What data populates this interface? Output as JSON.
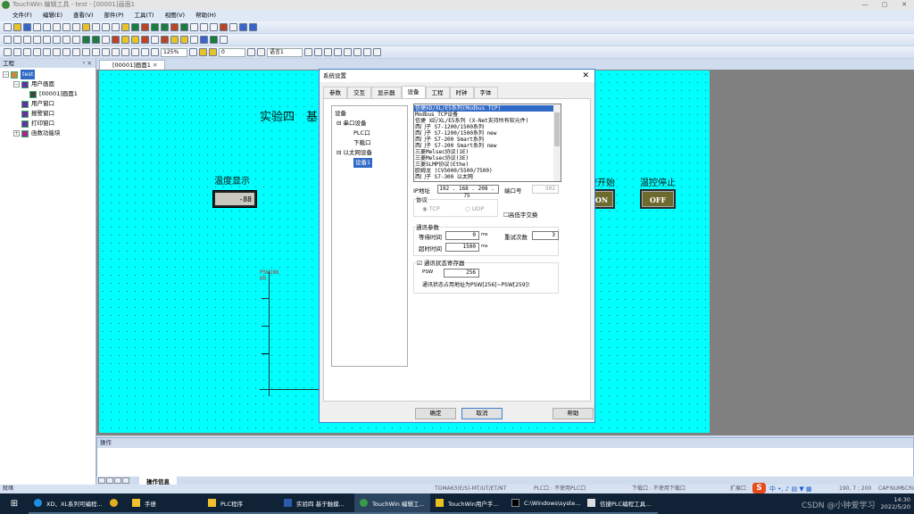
{
  "window": {
    "title": "TouchWin 编辑工具 - test - [00001]画面1",
    "controls": [
      "—",
      "▢",
      "✕"
    ]
  },
  "menu": [
    "文件(F)",
    "编辑(E)",
    "查看(V)",
    "部件(P)",
    "工具(T)",
    "视图(V)",
    "帮助(H)"
  ],
  "toolbar": {
    "zoom": "125%",
    "value": "0",
    "language": "语言1"
  },
  "project_panel": {
    "title": "工程",
    "pin": "ᵖ ✕",
    "tree": [
      {
        "label": "test",
        "level": 0,
        "selected": true
      },
      {
        "label": "用户画面",
        "level": 1
      },
      {
        "label": "[00001]画面1",
        "level": 2
      },
      {
        "label": "用户窗口",
        "level": 1
      },
      {
        "label": "报警窗口",
        "level": 1
      },
      {
        "label": "打印窗口",
        "level": 1
      },
      {
        "label": "函数功能块",
        "level": 1
      }
    ]
  },
  "editor": {
    "tab": "[00001]画面1",
    "close": "✕"
  },
  "canvas": {
    "title": "实验四　基",
    "temp_label": "温度显示",
    "temp_value": "-88",
    "start_label": "控开始",
    "start_btn": "ON",
    "stop_label": "温控停止",
    "stop_btn": "OFF",
    "trend_label": "PSW286",
    "trend_sub": "00",
    "colors": {
      "canvas": "#00ffff",
      "lamp": "#6c6a2c"
    }
  },
  "dialog": {
    "title": "系统设置",
    "close": "✕",
    "tabs": [
      "参数",
      "交互",
      "显示器",
      "设备",
      "工程",
      "时钟",
      "字体"
    ],
    "active_tab": "设备",
    "device_tree": [
      "设备",
      "串口设备",
      "PLC口",
      "下载口",
      "以太网设备",
      "设备1"
    ],
    "plc_list": [
      "信捷XD/XL/E5系列(Modbus TCP)",
      "Modbus_TCP设备",
      "信捷 XD/XL/E5系列 (X-Net支持所有软元件)",
      "西门子 S7-1200/1500系列",
      "西门子 S7-1200/1500系列 new",
      "西门子 S7-200 Smart系列",
      "西门子 S7-200 Smart系列 new",
      "三菱Melsec协议(1E)",
      "三菱Melsec协议(3E)",
      "三菱SLMP协议(Ethe)",
      "欧姆龙 (CV5000/5500/7500)",
      "西门子 S7-300 以太网"
    ],
    "ip_label": "IP地址",
    "ip": "192 . 168 . 208 . 75",
    "port_label": "端口号",
    "port": "502",
    "protocol_label": "协议",
    "tcp": "TCP",
    "udp": "UDP",
    "swap_label": "高低字交换",
    "comm_label": "通讯参数",
    "wait_label": "等待时间",
    "wait": "0",
    "ms": "ms",
    "retry_label": "重试次数",
    "retry": "3",
    "timeout_label": "超时时间",
    "timeout": "1500",
    "status_reg_label": "通讯状态寄存器",
    "psw_label": "PSW",
    "psw": "256",
    "note": "通讯状态占用地址为PSW[256]~PSW[259]!",
    "ok": "确定",
    "cancel": "取消",
    "help": "帮助"
  },
  "bottom_panel": {
    "title": "操作",
    "tab": "操作信息"
  },
  "statusbar": {
    "ready": "就绪",
    "model": "TGMA63(E/S)-MT/UT/ET/NT",
    "plc": "PLC口 : 不使用PLC口",
    "download": "下载口 : 不使用下载口",
    "ext": "扩展口 :",
    "pos": "190, 7 : 200",
    "caps": "CAP",
    "num": "NUM",
    "scrl": "SCRL"
  },
  "taskbar": {
    "items": [
      "XD、XL系列可编程...",
      "",
      "手册",
      "PLC程序",
      "实验四 基于触摸...",
      "TouchWin 编辑工...",
      "TouchWin用户手...",
      "C:\\Windows\\syste...",
      "信捷PLC编程工具..."
    ],
    "time": "14:30",
    "date": "2022/5/20",
    "tray_ime": "中",
    "watermark": "CSDN @小钟爱学习"
  }
}
